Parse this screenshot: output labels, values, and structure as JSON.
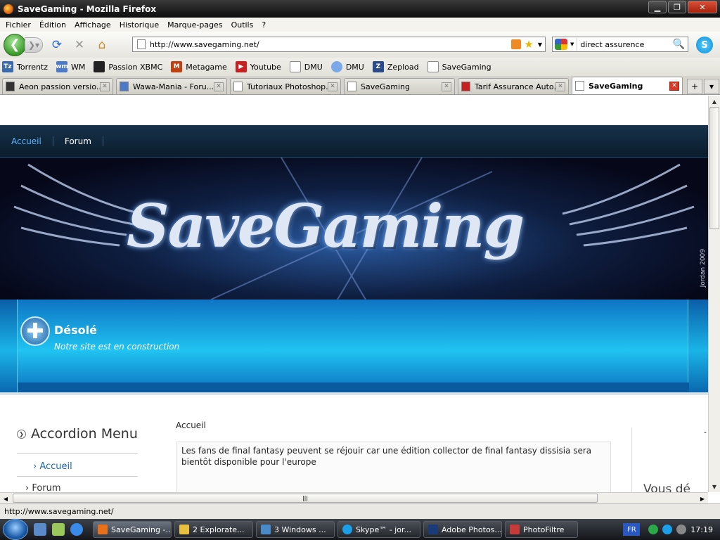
{
  "window": {
    "title": "SaveGaming - Mozilla Firefox"
  },
  "menu": [
    "Fichier",
    "Édition",
    "Affichage",
    "Historique",
    "Marque-pages",
    "Outils",
    "?"
  ],
  "nav": {
    "url": "http://www.savegaming.net/",
    "search_value": "direct assurence"
  },
  "bookmarks": [
    {
      "label": "Torrentz",
      "color": "#3a6ab0"
    },
    {
      "label": "WM",
      "color": "#4a7ac8"
    },
    {
      "label": "Passion XBMC",
      "color": "#222222"
    },
    {
      "label": "Metagame",
      "color": "#c04010"
    },
    {
      "label": "Youtube",
      "color": "#c82020"
    },
    {
      "label": "DMU",
      "color": "#ffffff"
    },
    {
      "label": "DMU",
      "color": "#7aa8e8"
    },
    {
      "label": "Zepload",
      "color": "#2a4a8a"
    },
    {
      "label": "SaveGaming",
      "color": "#ffffff"
    }
  ],
  "tabs": [
    {
      "label": "Aeon passion versio..."
    },
    {
      "label": "Wawa-Mania - Foru..."
    },
    {
      "label": "Tutoriaux Photoshop..."
    },
    {
      "label": "SaveGaming"
    },
    {
      "label": "Tarif Assurance Auto..."
    },
    {
      "label": "SaveGaming"
    }
  ],
  "site": {
    "nav": [
      "Accueil",
      "Forum"
    ],
    "logo": "SaveGaming",
    "signature": "Jordan 2009",
    "hero_title": "Désolé",
    "hero_subtitle": "Notre site est en construction",
    "accordion_title": "Accordion Menu",
    "accordion_items": [
      "Accueil",
      "Forum"
    ],
    "breadcrumb": "Accueil",
    "post_text": "Les fans de final fantasy peuvent se réjouir car une édition collector de final fantasy dissisia sera bientôt disponible pour l'europe",
    "right_title": "Vous dé",
    "right_dash": "-"
  },
  "status": {
    "text": "http://www.savegaming.net/"
  },
  "taskbar": {
    "tasks": [
      {
        "label": "SaveGaming -...",
        "color": "#e8701a"
      },
      {
        "label": "2 Explorate...",
        "color": "#e8c040"
      },
      {
        "label": "3 Windows ...",
        "color": "#4a8ac8"
      },
      {
        "label": "Skype™ - jor...",
        "color": "#1aa0e8"
      },
      {
        "label": "Adobe Photos...",
        "color": "#1a3a7a"
      },
      {
        "label": "PhotoFiltre",
        "color": "#c83a3a"
      }
    ],
    "lang": "FR",
    "clock": "17:19"
  },
  "colors": {
    "accent": "#5ab4ff",
    "hero": "#1ab4e8",
    "nav_bg": "#0b1c2c"
  }
}
